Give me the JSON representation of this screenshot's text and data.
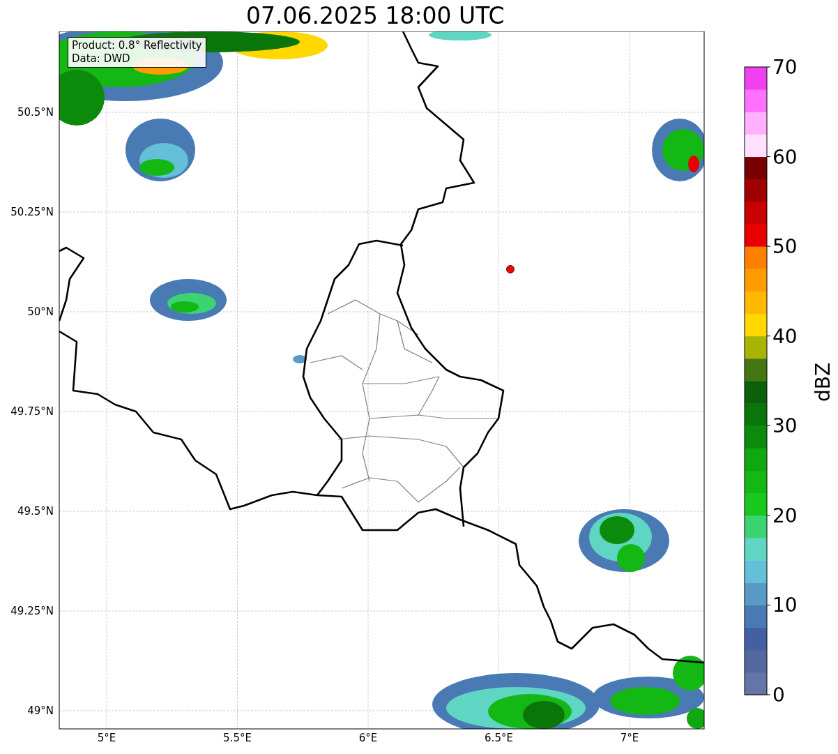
{
  "title": "07.06.2025 18:00 UTC",
  "map": {
    "info_lines": [
      "Product: 0.8° Reflectivity",
      "Data: DWD"
    ],
    "x_ticks": [
      "5°E",
      "5.5°E",
      "6°E",
      "6.5°E",
      "7°E"
    ],
    "y_ticks": [
      "50.5°N",
      "50.25°N",
      "50°N",
      "49.75°N",
      "49.5°N",
      "49.25°N",
      "49°N"
    ]
  },
  "colorbar": {
    "label": "dBZ",
    "ticks": [
      "70",
      "60",
      "50",
      "40",
      "30",
      "20",
      "10",
      "0"
    ],
    "bands": [
      {
        "color": "#6476a8"
      },
      {
        "color": "#5468a0"
      },
      {
        "color": "#4460a4"
      },
      {
        "color": "#4a7ab4"
      },
      {
        "color": "#5a9ac6"
      },
      {
        "color": "#64c0d8"
      },
      {
        "color": "#5fd6c4"
      },
      {
        "color": "#3cd470"
      },
      {
        "color": "#18c81c"
      },
      {
        "color": "#14b814"
      },
      {
        "color": "#10a810"
      },
      {
        "color": "#0c8a0c"
      },
      {
        "color": "#0a760a"
      },
      {
        "color": "#0a600a"
      },
      {
        "color": "#447614"
      },
      {
        "color": "#aab404"
      },
      {
        "color": "#ffd800"
      },
      {
        "color": "#ffb800"
      },
      {
        "color": "#ff9c00"
      },
      {
        "color": "#ff8000"
      },
      {
        "color": "#e80000"
      },
      {
        "color": "#c80000"
      },
      {
        "color": "#a00000"
      },
      {
        "color": "#780000"
      },
      {
        "color": "#ffe0ff"
      },
      {
        "color": "#ffb0ff"
      },
      {
        "color": "#ff70ff"
      },
      {
        "color": "#f040f0"
      }
    ]
  }
}
